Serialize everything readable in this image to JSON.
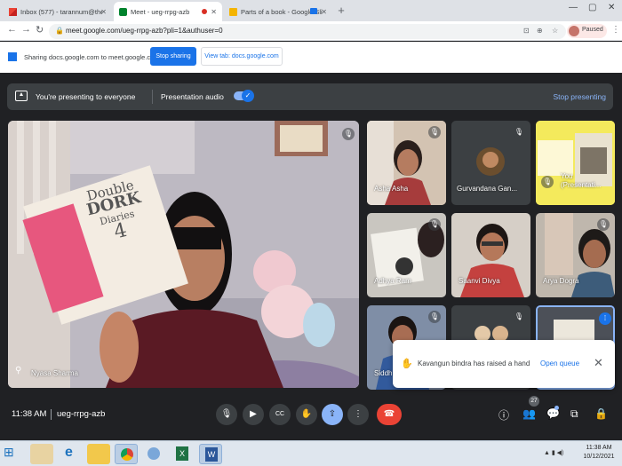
{
  "browser": {
    "tabs": [
      {
        "label": "Inbox (577) - tarannum@theindi",
        "favicon": "gmail-icon",
        "active": false
      },
      {
        "label": "Meet - ueg-rrpg-azb",
        "favicon": "meet-icon",
        "active": true
      },
      {
        "label": "Parts of a book - Google Sli",
        "favicon": "slides-icon",
        "active": false
      }
    ],
    "url": "meet.google.com/ueg-rrpg-azb?pli=1&authuser=0",
    "profile_status": "Paused"
  },
  "sharing_bar": {
    "text": "Sharing docs.google.com to meet.google.com",
    "stop_label": "Stop sharing",
    "view_label": "View tab: docs.google.com"
  },
  "meet": {
    "presenting_text": "You're presenting to everyone",
    "audio_label": "Presentation audio",
    "stop_presenting": "Stop presenting",
    "main_speaker": "Nyasa Sharma",
    "participants": [
      {
        "name": "Asha Asha"
      },
      {
        "name": "Gurvandana Gan..."
      },
      {
        "name": "You\n(Presentati..."
      },
      {
        "name": "Adhya Ram"
      },
      {
        "name": "Saanvi Divya"
      },
      {
        "name": "Arya Dogra"
      },
      {
        "name": "Siddh"
      }
    ],
    "toast": {
      "message": "Kavangun bindra has raised a hand",
      "action": "Open queue"
    },
    "time": "11:38 AM",
    "meeting_code": "ueg-rrpg-azb",
    "people_count": "27"
  },
  "book_cover": {
    "line1": "Double",
    "line2": "DORK",
    "line3": "Diaries",
    "line4": "4"
  },
  "taskbar": {
    "time": "11:38 AM",
    "date": "10/12/2021"
  },
  "colors": {
    "accent": "#1a73e8",
    "end_call": "#ea4335",
    "meet_bg": "#202124"
  }
}
